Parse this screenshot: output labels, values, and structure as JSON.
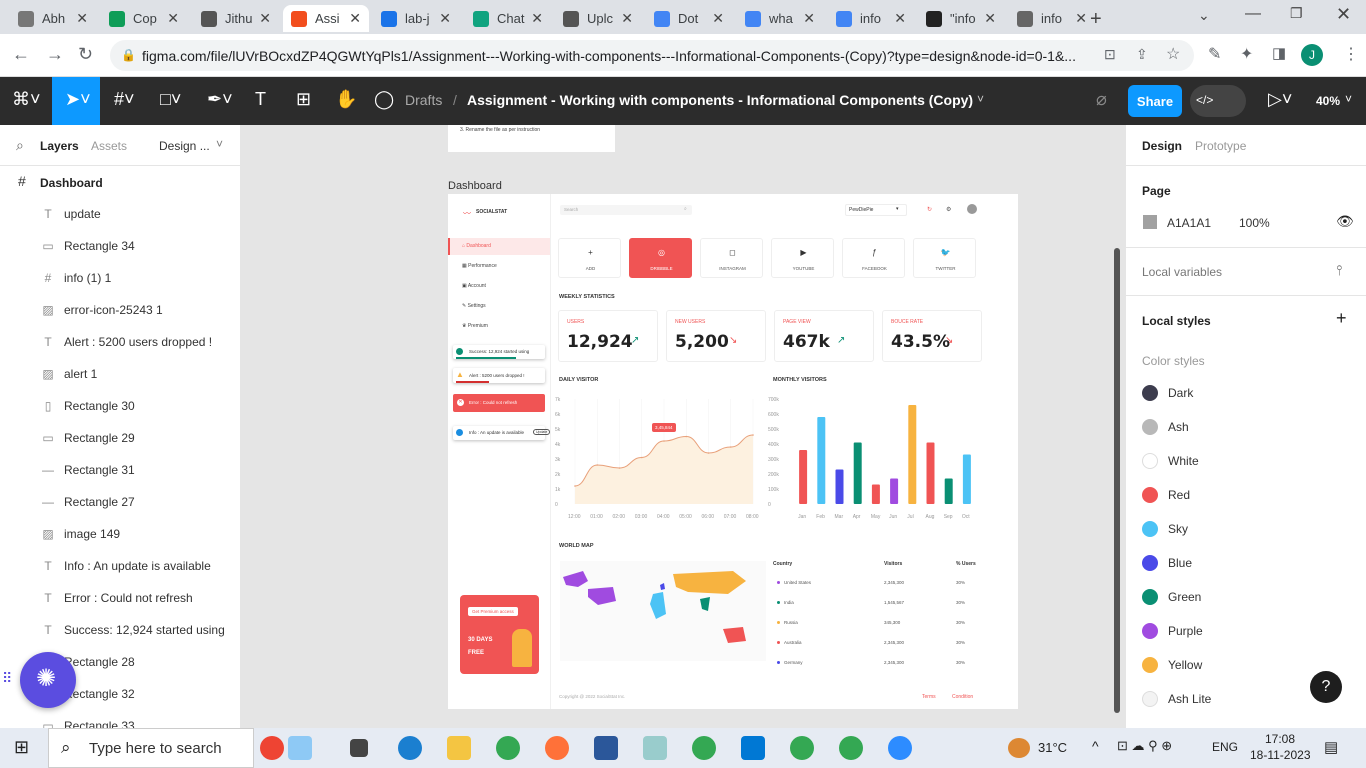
{
  "browser": {
    "tabs": [
      {
        "label": "Abh",
        "color": "#777"
      },
      {
        "label": "Cop",
        "color": "#0f9d58"
      },
      {
        "label": "Jithu",
        "color": "#555"
      },
      {
        "label": "Assi",
        "color": "#f24e1e",
        "active": true
      },
      {
        "label": "lab-j",
        "color": "#1a73e8"
      },
      {
        "label": "Chat",
        "color": "#10a37f"
      },
      {
        "label": "Uplc",
        "color": "#555"
      },
      {
        "label": "Dot",
        "color": "#4285f4"
      },
      {
        "label": "wha",
        "color": "#4285f4"
      },
      {
        "label": "info",
        "color": "#4285f4"
      },
      {
        "label": "\"info",
        "color": "#222"
      },
      {
        "label": "info",
        "color": "#666"
      }
    ],
    "url": "figma.com/file/lUVrBOcxdZP4QGWtYqPls1/Assignment---Working-with-components---Informational-Components-(Copy)?type=design&node-id=0-1&...",
    "profile_initial": "J"
  },
  "figma": {
    "breadcrumb_drafts": "Drafts",
    "breadcrumb_sep": "/",
    "file_title": "Assignment - Working with components - Informational Components (Copy)",
    "share_label": "Share",
    "zoom": "40%"
  },
  "left_panel": {
    "tabs": {
      "layers": "Layers",
      "assets": "Assets",
      "page": "Design ..."
    },
    "root": "Dashboard",
    "layers": [
      {
        "icon": "T",
        "label": "update"
      },
      {
        "icon": "▭",
        "label": "Rectangle 34"
      },
      {
        "icon": "#",
        "label": "info (1) 1"
      },
      {
        "icon": "▨",
        "label": "error-icon-25243 1"
      },
      {
        "icon": "T",
        "label": "Alert : 5200 users dropped !"
      },
      {
        "icon": "▨",
        "label": "alert 1"
      },
      {
        "icon": "▯",
        "label": "Rectangle 30"
      },
      {
        "icon": "▭",
        "label": "Rectangle 29"
      },
      {
        "icon": "—",
        "label": "Rectangle 31"
      },
      {
        "icon": "—",
        "label": "Rectangle 27"
      },
      {
        "icon": "▨",
        "label": "image 149"
      },
      {
        "icon": "T",
        "label": "Info : An update is available"
      },
      {
        "icon": "T",
        "label": "Error : Could not refresh"
      },
      {
        "icon": "T",
        "label": "Success: 12,924 started using"
      },
      {
        "icon": "▭",
        "label": "Rectangle 28"
      },
      {
        "icon": "▭",
        "label": "Rectangle 32"
      },
      {
        "icon": "▭",
        "label": "Rectangle 33"
      }
    ]
  },
  "canvas": {
    "top_note": "3. Rename the file as per instruction",
    "frame_label": "Dashboard",
    "design": {
      "brand": "SOCIALSTAT",
      "search_placeholder": "Search",
      "account": "PewDiePie",
      "nav": [
        "Dashboard",
        "Performance",
        "Account",
        "Settings",
        "Premium"
      ],
      "toasts": {
        "success": "Success: 12,924 started using",
        "alert": "Alert : 5200 users dropped !",
        "error": "Error : Could not refresh",
        "info": "Info : An update is available",
        "info_btn": "Update"
      },
      "channels": [
        "ADD",
        "DRIBBBLE",
        "INSTAGRAM",
        "YOUTUBE",
        "FACEBOOK",
        "TWITTER"
      ],
      "weekly_title": "WEEKLY STATISTICS",
      "stats": [
        {
          "label": "USERS",
          "value": "12,924",
          "trend": "up"
        },
        {
          "label": "NEW USERS",
          "value": "5,200",
          "trend": "down"
        },
        {
          "label": "PAGE VIEW",
          "value": "467k",
          "trend": "up"
        },
        {
          "label": "BOUCE RATE",
          "value": "43.5%",
          "trend": "down"
        }
      ],
      "daily_title": "DAILY VISITOR",
      "monthly_title": "MONTHLY VISITORS",
      "world_title": "WORLD MAP",
      "tooltip": "3,45,844",
      "table_headers": [
        "Country",
        "Visitors",
        "% Users"
      ],
      "table_rows": [
        {
          "country": "United States",
          "visitors": "2,345,300",
          "pct": "30%",
          "color": "#a04be0"
        },
        {
          "country": "India",
          "visitors": "1,545,567",
          "pct": "30%",
          "color": "#0a8f73"
        },
        {
          "country": "Russia",
          "visitors": "345,300",
          "pct": "30%",
          "color": "#f7b340"
        },
        {
          "country": "Australia",
          "visitors": "2,345,300",
          "pct": "30%",
          "color": "#f05454"
        },
        {
          "country": "Germany",
          "visitors": "2,345,300",
          "pct": "30%",
          "color": "#4a4ae8"
        }
      ],
      "promo": {
        "button": "Get Premium access",
        "line1": "30 DAYS",
        "line2": "FREE"
      },
      "footer": {
        "copyright": "Copyright @ 2022 SocialStat Inc.",
        "terms": "Terms",
        "conditions": "Condition"
      }
    }
  },
  "chart_data": [
    {
      "type": "area",
      "title": "DAILY VISITOR",
      "x": [
        "12:00",
        "01:00",
        "02:00",
        "03:00",
        "04:00",
        "05:00",
        "06:00",
        "07:00",
        "08:00"
      ],
      "yticks": [
        "0",
        "1k",
        "2k",
        "3k",
        "4k",
        "5k",
        "6k",
        "7k"
      ],
      "values": [
        1.2,
        2.6,
        2.4,
        3.1,
        4.2,
        4.5,
        3.4,
        3.8,
        4.6
      ],
      "ylim": [
        0,
        7
      ]
    },
    {
      "type": "bar",
      "title": "MONTHLY VISITORS",
      "categories": [
        "Jan",
        "Feb",
        "Mar",
        "Apr",
        "May",
        "Jun",
        "Jul",
        "Aug",
        "Sep",
        "Oct"
      ],
      "yticks": [
        "0",
        "100k",
        "200k",
        "300k",
        "400k",
        "500k",
        "600k",
        "700k"
      ],
      "values": [
        360,
        580,
        230,
        410,
        130,
        170,
        660,
        410,
        170,
        330
      ],
      "colors": [
        "#f05454",
        "#4cc3f5",
        "#4a4ae8",
        "#0a8f73",
        "#f05454",
        "#a04be0",
        "#f7b340",
        "#f05454",
        "#0a8f73",
        "#4cc3f5"
      ],
      "ylim": [
        0,
        700
      ]
    }
  ],
  "right_panel": {
    "tabs": {
      "design": "Design",
      "prototype": "Prototype"
    },
    "page_label": "Page",
    "page_color": "A1A1A1",
    "page_opacity": "100%",
    "local_variables": "Local variables",
    "local_styles": "Local styles",
    "color_styles_title": "Color styles",
    "colors": [
      {
        "name": "Dark",
        "hex": "#3d3d4e"
      },
      {
        "name": "Ash",
        "hex": "#b8b8b8"
      },
      {
        "name": "White",
        "hex": "#ffffff"
      },
      {
        "name": "Red",
        "hex": "#f05454"
      },
      {
        "name": "Sky",
        "hex": "#4cc3f5"
      },
      {
        "name": "Blue",
        "hex": "#4a4ae8"
      },
      {
        "name": "Green",
        "hex": "#0a8f73"
      },
      {
        "name": "Purple",
        "hex": "#a04be0"
      },
      {
        "name": "Yellow",
        "hex": "#f7b340"
      },
      {
        "name": "Ash Lite",
        "hex": "#f3f3f3"
      }
    ]
  },
  "taskbar": {
    "search_placeholder": "Type here to search",
    "weather": "31°C",
    "language": "ENG",
    "time": "17:08",
    "date": "18-11-2023"
  }
}
